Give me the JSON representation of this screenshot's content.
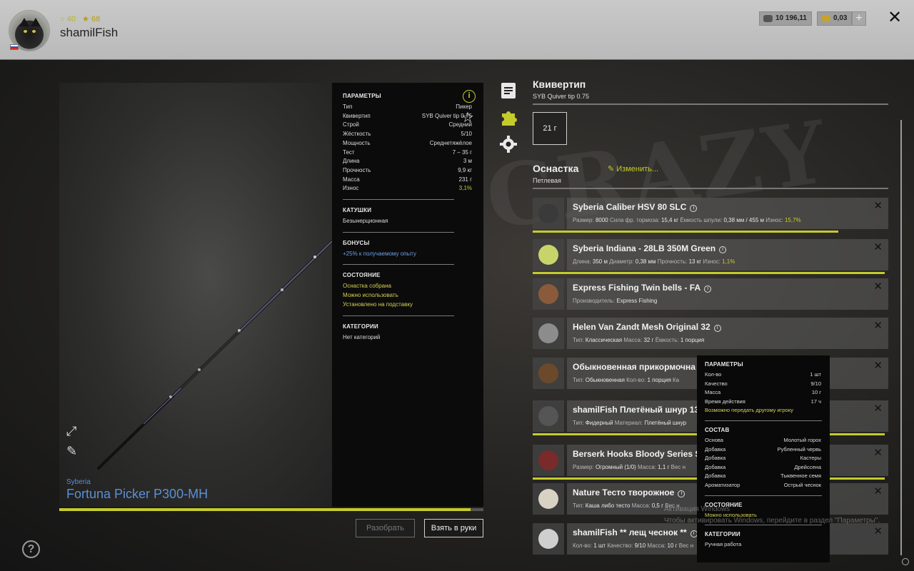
{
  "profile": {
    "xp": "40",
    "level": "68",
    "username": "shamilFish"
  },
  "currency": {
    "silver": "10 196,11",
    "gold": "0,03"
  },
  "rod": {
    "brand": "Syberia",
    "name": "Fortuna Picker P300-MH",
    "wear_percent": 97
  },
  "params_panel": {
    "parameters_title": "ПАРАМЕТРЫ",
    "rows": [
      {
        "label": "Тип",
        "value": "Пикер"
      },
      {
        "label": "Квивертип",
        "value": "SYB Quiver tip 0.75"
      },
      {
        "label": "Строй",
        "value": "Средний"
      },
      {
        "label": "Жёсткость",
        "value": "5/10"
      },
      {
        "label": "Мощность",
        "value": "Среднетяжёлое"
      },
      {
        "label": "Тест",
        "value": "7 – 35 г"
      },
      {
        "label": "Длина",
        "value": "3 м"
      },
      {
        "label": "Прочность",
        "value": "9,9 кг"
      },
      {
        "label": "Масса",
        "value": "231 г"
      },
      {
        "label": "Износ",
        "value": "3,1%"
      }
    ],
    "reels_title": "КАТУШКИ",
    "reels_value": "Безынерционная",
    "bonuses_title": "БОНУСЫ",
    "bonuses_value": "+25% к получаемому опыту",
    "state_title": "СОСТОЯНИЕ",
    "state_values": [
      "Оснастка собрана",
      "Можно использовать",
      "Установлено на подставку"
    ],
    "categories_title": "КАТЕГОРИИ",
    "categories_value": "Нет категорий"
  },
  "buttons": {
    "disassemble": "Разобрать",
    "take": "Взять в руки"
  },
  "quiver": {
    "title": "Квивертип",
    "subtitle": "SYB Quiver tip 0.75",
    "weight": "21 г"
  },
  "rig": {
    "title": "Оснастка",
    "edit": "Изменить...",
    "subtitle": "Петлевая"
  },
  "items": [
    {
      "name": "Syberia Caliber HSV 80 SLC",
      "meta": [
        [
          "Размер: ",
          "8000"
        ],
        [
          "  Сила фр. тормоза: ",
          "15,4 кг"
        ],
        [
          "  Ёмкость шпули: ",
          "0,38 мм / 455 м"
        ],
        [
          "  Износ: ",
          "15,7%"
        ]
      ],
      "wear": 0.86,
      "color": "#3a3a3a"
    },
    {
      "name": "Syberia Indiana - 28LB 350M Green",
      "meta": [
        [
          "Длина: ",
          "350 м"
        ],
        [
          "  Диаметр: ",
          "0,38 мм"
        ],
        [
          "  Прочность: ",
          "13 кг"
        ],
        [
          "  Износ: ",
          "1,1%"
        ]
      ],
      "wear": 0.99,
      "color": "#c8d46a"
    },
    {
      "name": "Express Fishing Twin bells - FA",
      "meta": [
        [
          "Производитель: ",
          "Express Fishing"
        ]
      ],
      "wear": 0,
      "color": "#8a5a3a"
    },
    {
      "name": "Helen Van Zandt Mesh Original 32",
      "meta": [
        [
          "Тип: ",
          "Классическая"
        ],
        [
          "  Масса: ",
          "32 г"
        ],
        [
          "  Ёмкость: ",
          "1 порция"
        ]
      ],
      "wear": 0,
      "color": "#8c8c8c"
    },
    {
      "name": "Обыкновенная прикормочна",
      "meta": [
        [
          "Тип: ",
          "Обыкновенная"
        ],
        [
          "  Кол-во: ",
          "1 порция"
        ],
        [
          "  Ка",
          ""
        ]
      ],
      "wear": 0,
      "color": "#6a4a2a"
    },
    {
      "name": "shamilFish Плетёный шнур 13",
      "meta": [
        [
          "Тип: ",
          "Фидерный"
        ],
        [
          "  Материал: ",
          "Плетёный шнур"
        ]
      ],
      "wear": 0.99,
      "color": "#555"
    },
    {
      "name": "Berserk Hooks Bloody Series S1",
      "meta": [
        [
          "Размер: ",
          "Огромный (1/0)"
        ],
        [
          "  Масса: ",
          "1,1 г"
        ],
        [
          "  Вес н",
          ""
        ]
      ],
      "wear": 0.99,
      "color": "#7a2a2a"
    },
    {
      "name": "Nature Тесто творожное",
      "meta": [
        [
          "Тип: ",
          "Каша либо тесто"
        ],
        [
          "  Масса: ",
          "0,5 г"
        ],
        [
          "  Вес н",
          ""
        ]
      ],
      "wear": 0,
      "color": "#d8d2c2"
    },
    {
      "name": "shamilFish ** лещ чеснок **",
      "meta": [
        [
          "Кол-во: ",
          "1 шт"
        ],
        [
          "  Качество: ",
          "9/10"
        ],
        [
          "  Масса: ",
          "10 г"
        ],
        [
          "  Вес н",
          ""
        ]
      ],
      "wear": 0,
      "color": "#cfcfcf"
    }
  ],
  "tooltip": {
    "parameters_title": "ПАРАМЕТРЫ",
    "rows": [
      {
        "label": "Кол-во",
        "value": "1 шт"
      },
      {
        "label": "Качество",
        "value": "9/10"
      },
      {
        "label": "Масса",
        "value": "10 г"
      },
      {
        "label": "Время действия",
        "value": "17 ч"
      }
    ],
    "transfer": "Возможно передать другому игроку",
    "composition_title": "СОСТАВ",
    "composition": [
      {
        "label": "Основа",
        "value": "Молотый горох"
      },
      {
        "label": "Добавка",
        "value": "Рубленный червь"
      },
      {
        "label": "Добавка",
        "value": "Кастеры"
      },
      {
        "label": "Добавка",
        "value": "Дрейссена"
      },
      {
        "label": "Добавка",
        "value": "Тыквенное семя"
      },
      {
        "label": "Ароматизатор",
        "value": "Острый чеснок"
      }
    ],
    "state_title": "СОСТОЯНИЕ",
    "state_value": "Можно использовать",
    "categories_title": "КАТЕГОРИИ",
    "categories_value": "Ручная работа"
  },
  "watermark": {
    "line1": "Активация Windows",
    "line2": "Чтобы активировать Windows, перейдите в раздел \"Параметры\"."
  },
  "colors": {
    "accent": "#c4cc2c",
    "brand_blue": "#5c8fd6"
  }
}
